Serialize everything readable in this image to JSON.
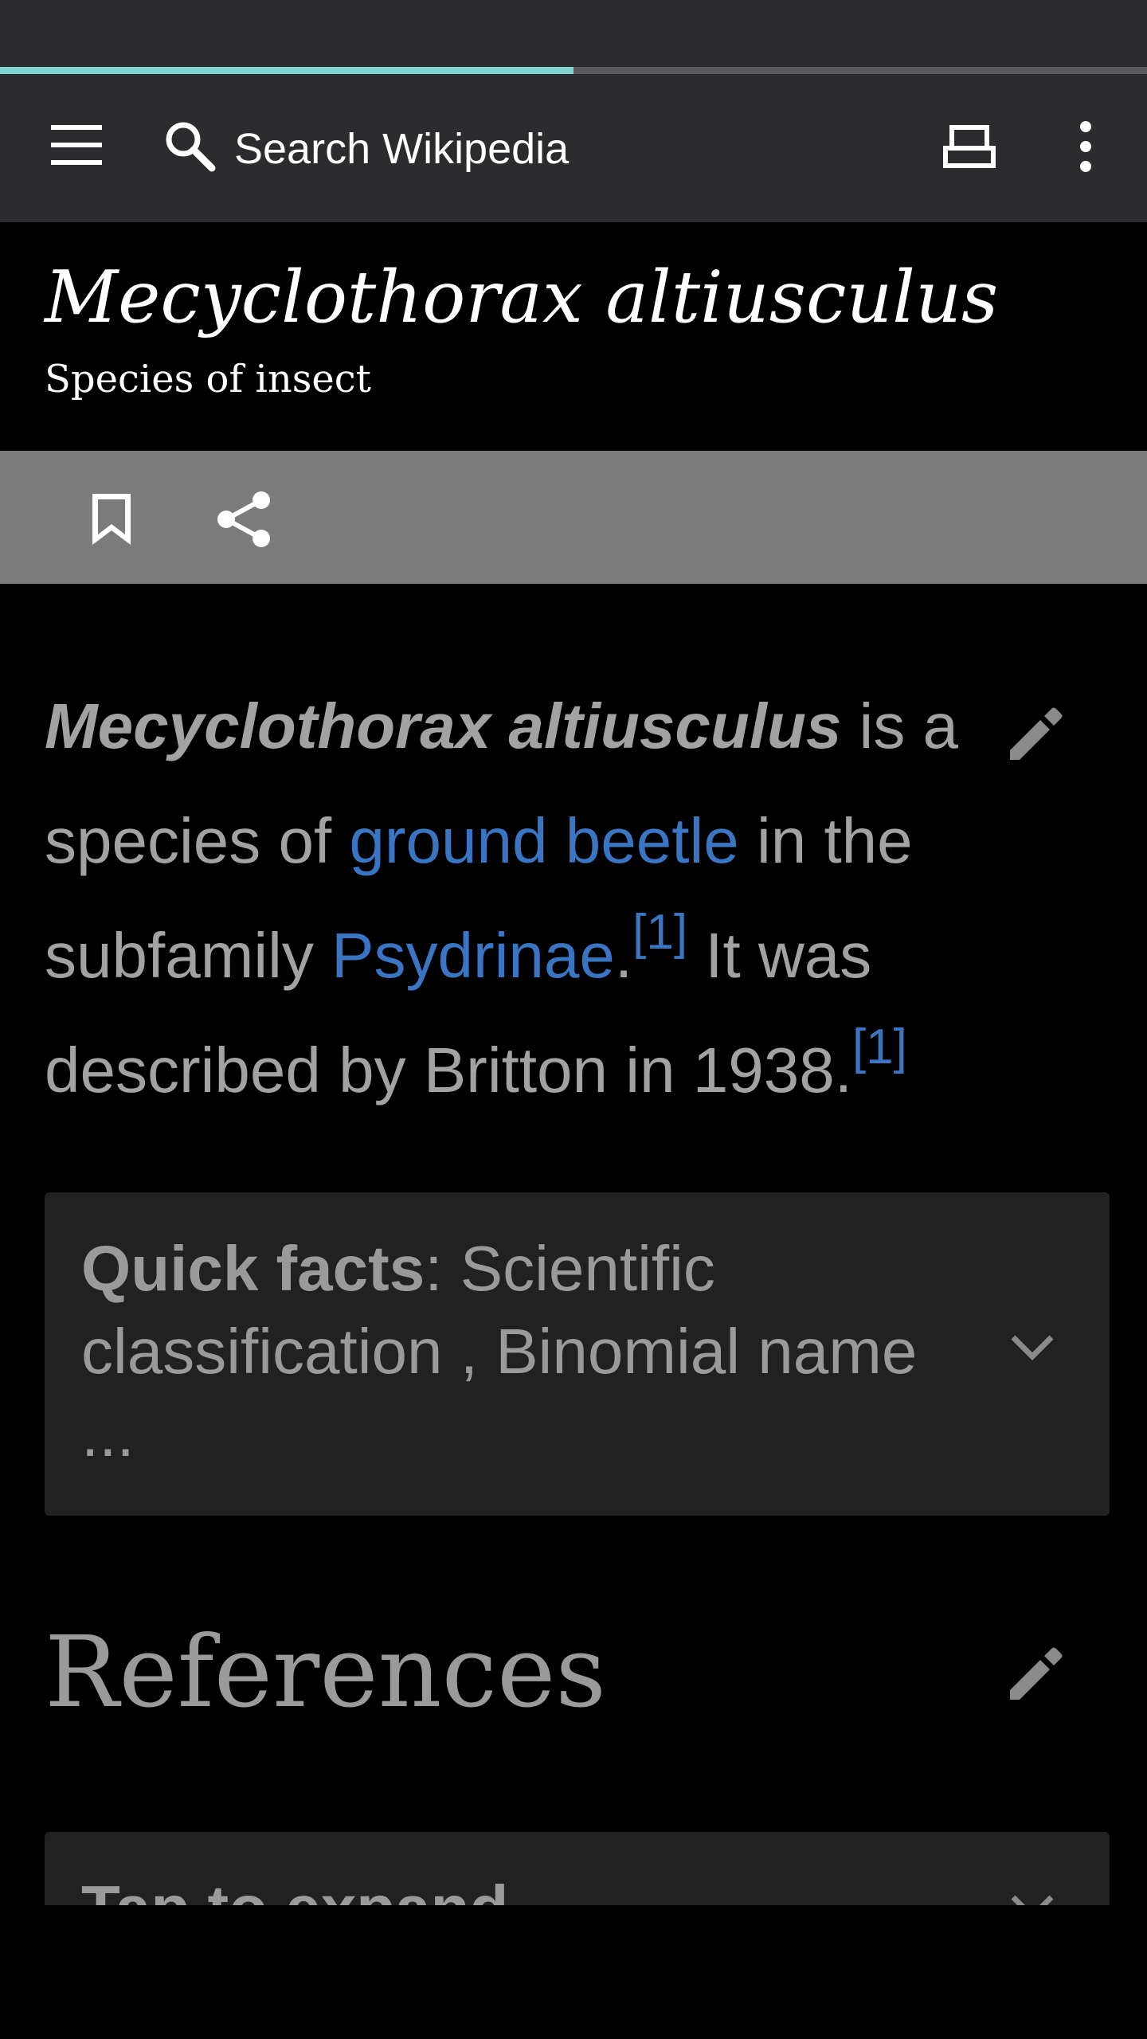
{
  "toolbar": {
    "search_placeholder": "Search Wikipedia",
    "menu_icon": "hamburger-menu-icon",
    "search_icon": "search-icon",
    "tabs_icon": "tabs-icon",
    "overflow_icon": "more-vert-icon"
  },
  "page_load_progress": 0.5,
  "article": {
    "title": "Mecyclothorax altiusculus",
    "description": "Species of insect"
  },
  "actions": {
    "bookmark_icon": "bookmark-icon",
    "share_icon": "share-icon"
  },
  "lead": {
    "bold_name": "Mecyclothorax altiusculus",
    "text_1": " is a species of ",
    "link_1": "ground beetle",
    "text_2": " in the subfamily ",
    "link_2": "Psydrinae",
    "text_3": ".",
    "ref_1": "[1]",
    "text_4": " It was described by Britton in 1938.",
    "ref_2": "[1]"
  },
  "quick_facts": {
    "label": "Quick facts",
    "text": ": Scientific classification , Binomial name ..."
  },
  "references": {
    "heading": "References",
    "collapsed_label": "Tap to expand"
  },
  "colors": {
    "toolbar_bg": "#2c2c2e",
    "progress_accent": "#7fd4cf",
    "link": "#3a75c4",
    "action_bar_bg": "#7b7b7b",
    "body_text": "#a2a2a2",
    "card_bg": "#212121"
  }
}
